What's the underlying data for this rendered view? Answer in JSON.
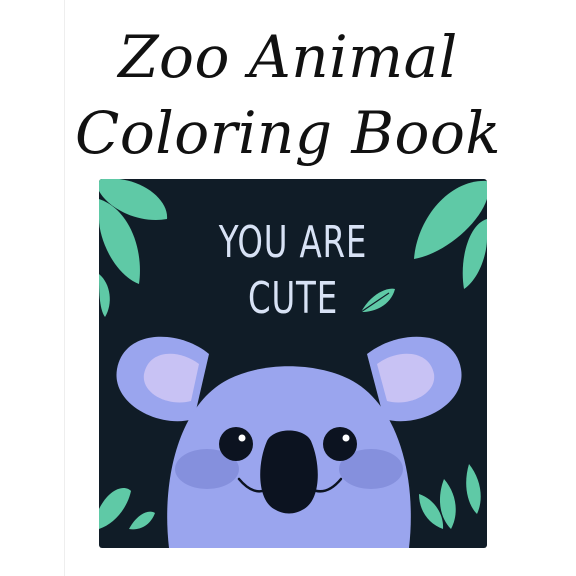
{
  "cover": {
    "title_line_1": "Zoo Animal",
    "title_line_2": "Coloring Book",
    "slogan_line_1": "YOU ARE",
    "slogan_line_2": "CUTE"
  },
  "colors": {
    "panel_background": "#101c27",
    "leaf_green": "#5fc9a6",
    "koala_body": "#9aa5ee",
    "koala_inner_ear": "#c8c2f4",
    "koala_nose": "#0c1320",
    "slogan_text": "#d8e2f5"
  }
}
